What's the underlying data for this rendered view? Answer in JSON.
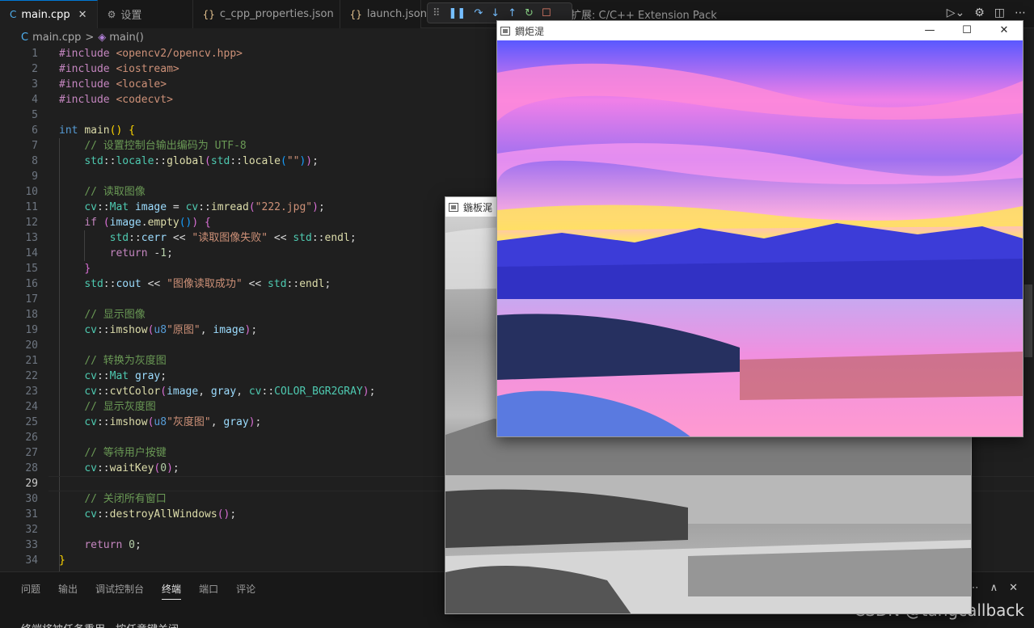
{
  "tabs": [
    {
      "icon": "C",
      "label": "main.cpp",
      "active": true,
      "close": "✕"
    },
    {
      "icon": "⚙",
      "label": "设置"
    },
    {
      "icon": "{}",
      "label": "c_cpp_properties.json"
    },
    {
      "icon": "{}",
      "label": "launch.json"
    }
  ],
  "ext_tab": "扩展: C/C++ Extension Pack",
  "breadcrumb": {
    "file": "main.cpp",
    "sep": ">",
    "symbol": "main()"
  },
  "current_line": 29,
  "code_lines": [
    {
      "n": "1",
      "html": "<span class='pp'>#include</span> <span class='inc'>&lt;opencv2/opencv.hpp&gt;</span>"
    },
    {
      "n": "2",
      "html": "<span class='pp'>#include</span> <span class='inc'>&lt;iostream&gt;</span>"
    },
    {
      "n": "3",
      "html": "<span class='pp'>#include</span> <span class='inc'>&lt;locale&gt;</span>"
    },
    {
      "n": "4",
      "html": "<span class='pp'>#include</span> <span class='inc'>&lt;codecvt&gt;</span>"
    },
    {
      "n": "5",
      "html": ""
    },
    {
      "n": "6",
      "html": "<span class='kw'>int</span> <span class='fn'>main</span><span class='br'>()</span> <span class='br'>{</span>"
    },
    {
      "n": "7",
      "html": "    <span class='com'>// 设置控制台输出编码为 UTF-8</span>"
    },
    {
      "n": "8",
      "html": "    <span class='ty'>std</span><span class='pl'>::</span><span class='ty'>locale</span><span class='pl'>::</span><span class='fn'>global</span><span class='br2'>(</span><span class='ty'>std</span><span class='pl'>::</span><span class='fn'>locale</span><span class='br3'>(</span><span class='str'>\"\"</span><span class='br3'>)</span><span class='br2'>)</span><span class='pl'>;</span>"
    },
    {
      "n": "9",
      "html": ""
    },
    {
      "n": "10",
      "html": "    <span class='com'>// 读取图像</span>"
    },
    {
      "n": "11",
      "html": "    <span class='ty'>cv</span><span class='pl'>::</span><span class='ty'>Mat</span> <span class='var'>image</span> <span class='pl'>=</span> <span class='ty'>cv</span><span class='pl'>::</span><span class='fn'>imread</span><span class='br2'>(</span><span class='str'>\"222.jpg\"</span><span class='br2'>)</span><span class='pl'>;</span>"
    },
    {
      "n": "12",
      "html": "    <span class='pp'>if</span> <span class='br2'>(</span><span class='var'>image</span><span class='pl'>.</span><span class='fn'>empty</span><span class='br3'>()</span><span class='br2'>)</span> <span class='br2'>{</span>"
    },
    {
      "n": "13",
      "html": "        <span class='ty'>std</span><span class='pl'>::</span><span class='var'>cerr</span> <span class='pl'>&lt;&lt;</span> <span class='str'>\"读取图像失败\"</span> <span class='pl'>&lt;&lt;</span> <span class='ty'>std</span><span class='pl'>::</span><span class='fn'>endl</span><span class='pl'>;</span>"
    },
    {
      "n": "14",
      "html": "        <span class='pp'>return</span> <span class='pl'>-</span><span class='num'>1</span><span class='pl'>;</span>"
    },
    {
      "n": "15",
      "html": "    <span class='br2'>}</span>"
    },
    {
      "n": "16",
      "html": "    <span class='ty'>std</span><span class='pl'>::</span><span class='var'>cout</span> <span class='pl'>&lt;&lt;</span> <span class='str'>\"图像读取成功\"</span> <span class='pl'>&lt;&lt;</span> <span class='ty'>std</span><span class='pl'>::</span><span class='fn'>endl</span><span class='pl'>;</span>"
    },
    {
      "n": "17",
      "html": ""
    },
    {
      "n": "18",
      "html": "    <span class='com'>// 显示图像</span>"
    },
    {
      "n": "19",
      "html": "    <span class='ty'>cv</span><span class='pl'>::</span><span class='fn'>imshow</span><span class='br2'>(</span><span class='kw'>u8</span><span class='str'>\"原图\"</span><span class='pl'>,</span> <span class='var'>image</span><span class='br2'>)</span><span class='pl'>;</span>"
    },
    {
      "n": "20",
      "html": ""
    },
    {
      "n": "21",
      "html": "    <span class='com'>// 转换为灰度图</span>"
    },
    {
      "n": "22",
      "html": "    <span class='ty'>cv</span><span class='pl'>::</span><span class='ty'>Mat</span> <span class='var'>gray</span><span class='pl'>;</span>"
    },
    {
      "n": "23",
      "html": "    <span class='ty'>cv</span><span class='pl'>::</span><span class='fn'>cvtColor</span><span class='br2'>(</span><span class='var'>image</span><span class='pl'>,</span> <span class='var'>gray</span><span class='pl'>,</span> <span class='ty'>cv</span><span class='pl'>::</span><span class='ty'>COLOR_BGR2GRAY</span><span class='br2'>)</span><span class='pl'>;</span>"
    },
    {
      "n": "24",
      "html": "    <span class='com'>// 显示灰度图</span>"
    },
    {
      "n": "25",
      "html": "    <span class='ty'>cv</span><span class='pl'>::</span><span class='fn'>imshow</span><span class='br2'>(</span><span class='kw'>u8</span><span class='str'>\"灰度图\"</span><span class='pl'>,</span> <span class='var'>gray</span><span class='br2'>)</span><span class='pl'>;</span>"
    },
    {
      "n": "26",
      "html": ""
    },
    {
      "n": "27",
      "html": "    <span class='com'>// 等待用户按键</span>"
    },
    {
      "n": "28",
      "html": "    <span class='ty'>cv</span><span class='pl'>::</span><span class='fn'>waitKey</span><span class='br2'>(</span><span class='num'>0</span><span class='br2'>)</span><span class='pl'>;</span>"
    },
    {
      "n": "29",
      "html": ""
    },
    {
      "n": "30",
      "html": "    <span class='com'>// 关闭所有窗口</span>"
    },
    {
      "n": "31",
      "html": "    <span class='ty'>cv</span><span class='pl'>::</span><span class='fn'>destroyAllWindows</span><span class='br2'>()</span><span class='pl'>;</span>"
    },
    {
      "n": "32",
      "html": ""
    },
    {
      "n": "33",
      "html": "    <span class='pp'>return</span> <span class='num'>0</span><span class='pl'>;</span>"
    },
    {
      "n": "34",
      "html": "<span class='br'>}</span>"
    }
  ],
  "panel_tabs": [
    "问题",
    "输出",
    "调试控制台",
    "终端",
    "端口",
    "评论"
  ],
  "panel_active": "终端",
  "terminal_text": "终端将被任务重用，按任意键关闭。",
  "watermark": "CSDN @tangcallback",
  "win_color": {
    "title": "鐧炬湜"
  },
  "win_gray": {
    "title": "鍦板浘"
  },
  "win_buttons": [
    "—",
    "☐",
    "✕"
  ],
  "colors": {
    "accent": "#0078d4",
    "editor_bg": "#1f1f1f"
  }
}
